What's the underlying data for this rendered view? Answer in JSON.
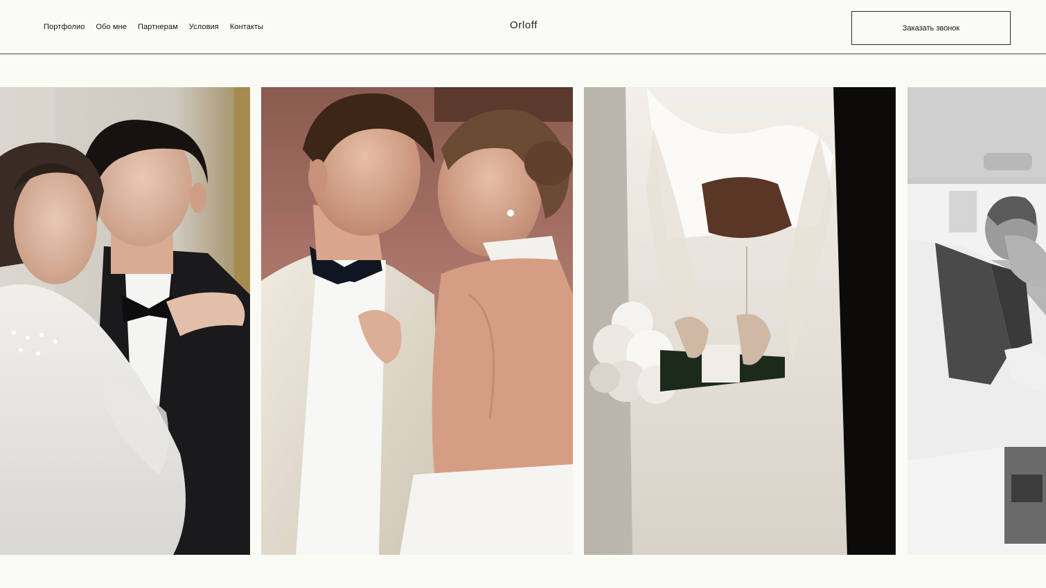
{
  "header": {
    "nav": [
      "Портфолио",
      "Обо мне",
      "Партнерам",
      "Условия",
      "Контакты"
    ],
    "logo": "Orloff",
    "cta_label": "Заказать звонок"
  },
  "gallery": {
    "photos": [
      {
        "subject": "bride and groom in tuxedo smiling cheek to cheek"
      },
      {
        "subject": "couple in white dinner jacket and backless halter dress, foreheads touching"
      },
      {
        "subject": "bride holding white bouquet behind her back, veil and gloves"
      },
      {
        "subject": "black and white photo of man in vest covering face, inside a car"
      }
    ]
  }
}
